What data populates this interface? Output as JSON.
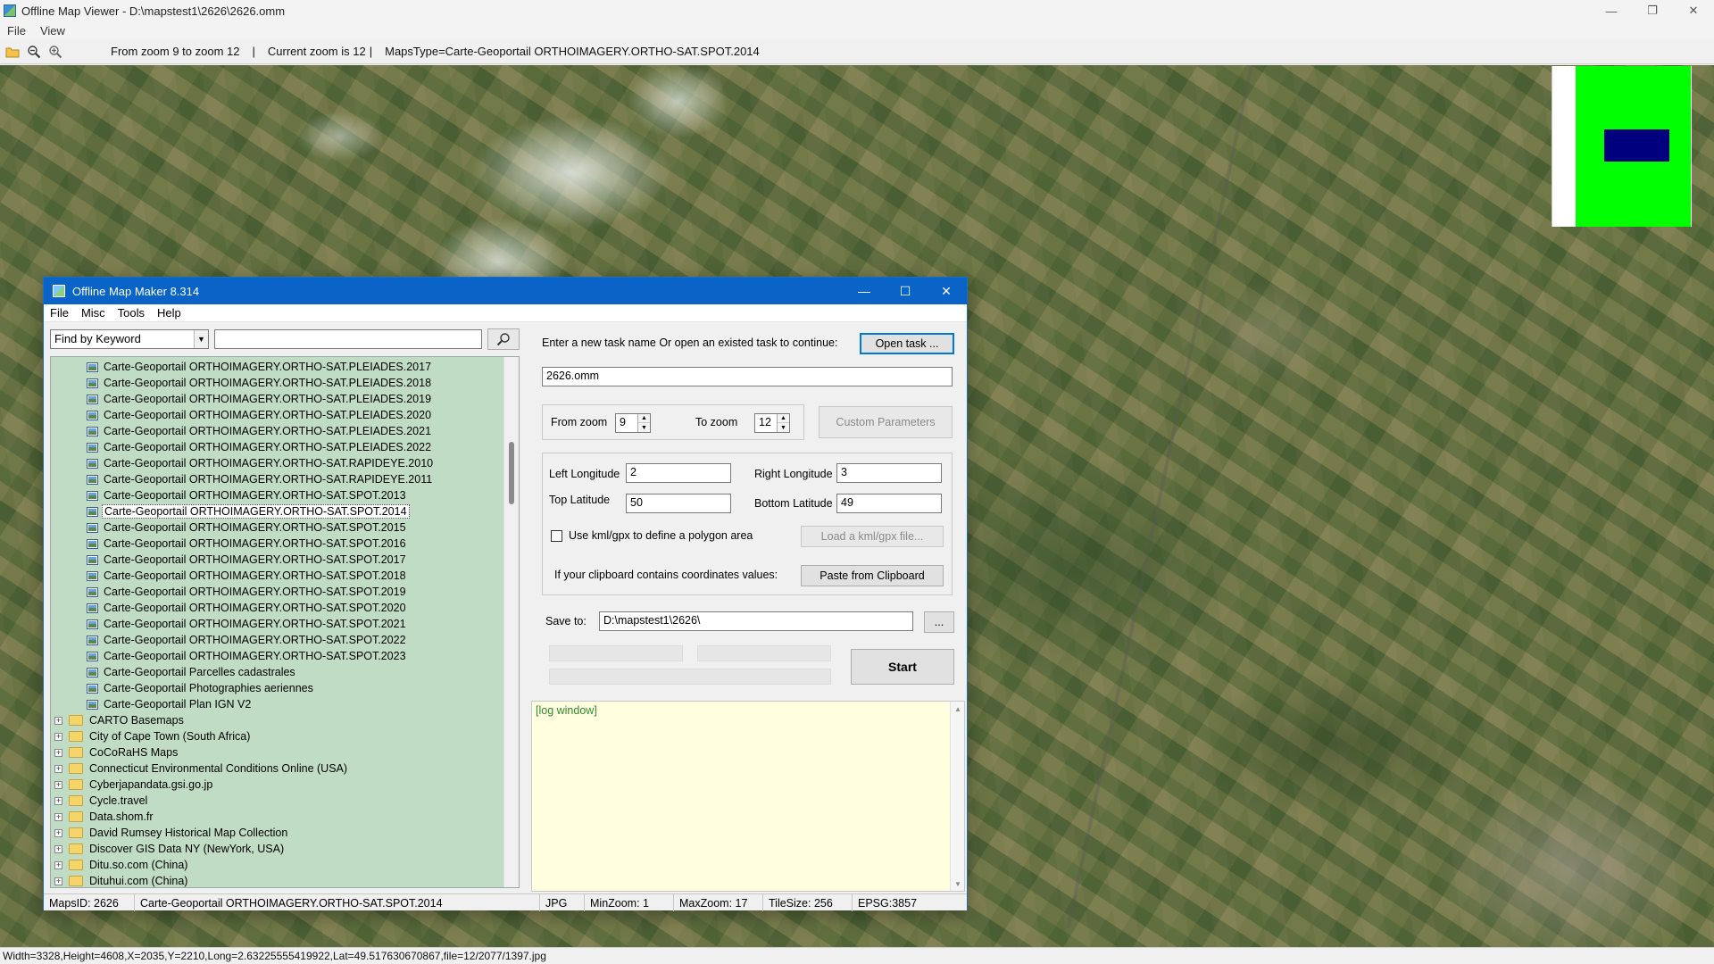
{
  "main_window": {
    "title": "Offline Map Viewer - D:\\mapstest1\\2626\\2626.omm",
    "menu": [
      "File",
      "View"
    ],
    "toolbar": {
      "zoom_range": "From zoom 9 to zoom 12",
      "separator": "|",
      "current_zoom": "Current zoom is 12",
      "maps_type": "MapsType=Carte-Geoportail ORTHOIMAGERY.ORTHO-SAT.SPOT.2014"
    },
    "status_bar": "Width=3328,Height=4608,X=2035,Y=2210,Long=2.63225555419922,Lat=49.517630670867,file=12/2077/1397.jpg",
    "overview_colors": {
      "background": "#00ff00",
      "viewport": "#00007f"
    }
  },
  "dialog": {
    "title": "Offline Map Maker 8.314",
    "menu": [
      "File",
      "Misc",
      "Tools",
      "Help"
    ],
    "search": {
      "mode": "Find by Keyword",
      "query": ""
    },
    "tree": {
      "leaf_items": [
        "Carte-Geoportail ORTHOIMAGERY.ORTHO-SAT.PLEIADES.2017",
        "Carte-Geoportail ORTHOIMAGERY.ORTHO-SAT.PLEIADES.2018",
        "Carte-Geoportail ORTHOIMAGERY.ORTHO-SAT.PLEIADES.2019",
        "Carte-Geoportail ORTHOIMAGERY.ORTHO-SAT.PLEIADES.2020",
        "Carte-Geoportail ORTHOIMAGERY.ORTHO-SAT.PLEIADES.2021",
        "Carte-Geoportail ORTHOIMAGERY.ORTHO-SAT.PLEIADES.2022",
        "Carte-Geoportail ORTHOIMAGERY.ORTHO-SAT.RAPIDEYE.2010",
        "Carte-Geoportail ORTHOIMAGERY.ORTHO-SAT.RAPIDEYE.2011",
        "Carte-Geoportail ORTHOIMAGERY.ORTHO-SAT.SPOT.2013",
        "Carte-Geoportail ORTHOIMAGERY.ORTHO-SAT.SPOT.2014",
        "Carte-Geoportail ORTHOIMAGERY.ORTHO-SAT.SPOT.2015",
        "Carte-Geoportail ORTHOIMAGERY.ORTHO-SAT.SPOT.2016",
        "Carte-Geoportail ORTHOIMAGERY.ORTHO-SAT.SPOT.2017",
        "Carte-Geoportail ORTHOIMAGERY.ORTHO-SAT.SPOT.2018",
        "Carte-Geoportail ORTHOIMAGERY.ORTHO-SAT.SPOT.2019",
        "Carte-Geoportail ORTHOIMAGERY.ORTHO-SAT.SPOT.2020",
        "Carte-Geoportail ORTHOIMAGERY.ORTHO-SAT.SPOT.2021",
        "Carte-Geoportail ORTHOIMAGERY.ORTHO-SAT.SPOT.2022",
        "Carte-Geoportail ORTHOIMAGERY.ORTHO-SAT.SPOT.2023",
        "Carte-Geoportail Parcelles cadastrales",
        "Carte-Geoportail Photographies aeriennes",
        "Carte-Geoportail Plan IGN V2"
      ],
      "selected_index": 9,
      "folders": [
        "CARTO Basemaps",
        "City of Cape Town (South Africa)",
        "CoCoRaHS Maps",
        "Connecticut Environmental Conditions Online (USA)",
        "Cyberjapandata.gsi.go.jp",
        "Cycle.travel",
        "Data.shom.fr",
        "David Rumsey Historical Map Collection",
        "Discover GIS Data NY (NewYork, USA)",
        "Ditu.so.com (China)",
        "Dituhui.com (China)"
      ],
      "background": "#c1dcc4"
    },
    "task": {
      "prompt": "Enter a new task name Or open an existed task to continue:",
      "open_button": "Open task ...",
      "name": "2626.omm"
    },
    "zoom": {
      "from_label": "From zoom",
      "from_value": "9",
      "to_label": "To zoom",
      "to_value": "12",
      "custom_button": "Custom Parameters"
    },
    "bounds": {
      "left_label": "Left Longitude",
      "left_value": "2",
      "right_label": "Right Longitude",
      "right_value": "3",
      "top_label": "Top Latitude",
      "top_value": "50",
      "bottom_label": "Bottom Latitude",
      "bottom_value": "49"
    },
    "polygon": {
      "checkbox_label": "Use kml/gpx to define a polygon area",
      "load_button": "Load a kml/gpx file..."
    },
    "clipboard": {
      "label": "If your clipboard contains coordinates values:",
      "button": "Paste from Clipboard"
    },
    "save": {
      "label": "Save to:",
      "path": "D:\\mapstest1\\2626\\",
      "browse_button": "..."
    },
    "start_button": "Start",
    "log": "[log window]",
    "status": {
      "maps_id": "MapsID: 2626",
      "map_name": "Carte-Geoportail ORTHOIMAGERY.ORTHO-SAT.SPOT.2014",
      "format": "JPG",
      "min_zoom": "MinZoom: 1",
      "max_zoom": "MaxZoom: 17",
      "tile_size": "TileSize: 256",
      "epsg": "EPSG:3857"
    }
  }
}
